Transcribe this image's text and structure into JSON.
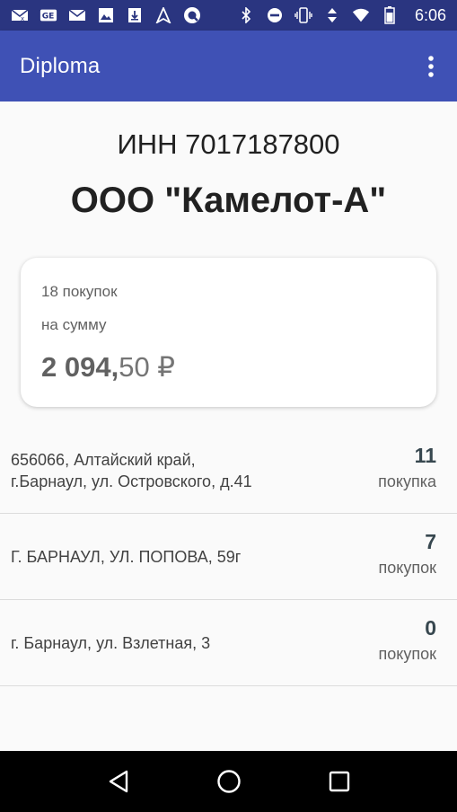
{
  "status_bar": {
    "time": "6:06",
    "left_icons": [
      "mail-muted-icon",
      "ge-icon",
      "mail-icon",
      "image-icon",
      "download-icon",
      "nav-arrow-icon",
      "q-icon"
    ],
    "right_icons": [
      "bluetooth-icon",
      "dnd-icon",
      "vibrate-icon",
      "data-arrows-icon",
      "wifi-icon",
      "battery-icon"
    ]
  },
  "app_bar": {
    "title": "Diploma",
    "menu_icon": "more-vert-icon"
  },
  "header": {
    "inn": "ИНН 7017187800",
    "organization": "ООО \"Камелот-А\""
  },
  "summary_card": {
    "purchases_count": "18 покупок",
    "sum_label": "на сумму",
    "amount_integer": "2 094,",
    "amount_fraction": "50 ₽"
  },
  "stores": [
    {
      "address_line1": "656066, Алтайский край,",
      "address_line2": "г.Барнаул, ул. Островского, д.41",
      "count": "11",
      "unit": "покупка"
    },
    {
      "address_line1": "Г. БАРНАУЛ, УЛ. ПОПОВА, 59г",
      "address_line2": "",
      "count": "7",
      "unit": "покупок"
    },
    {
      "address_line1": "г. Барнаул, ул. Взлетная, 3",
      "address_line2": "",
      "count": "0",
      "unit": "покупок"
    }
  ],
  "colors": {
    "status_bar": "#2a3580",
    "app_bar": "#3f51b5",
    "background": "#fafafa"
  },
  "nav_bar": {
    "buttons": [
      "back-icon",
      "home-icon",
      "recents-icon"
    ]
  }
}
